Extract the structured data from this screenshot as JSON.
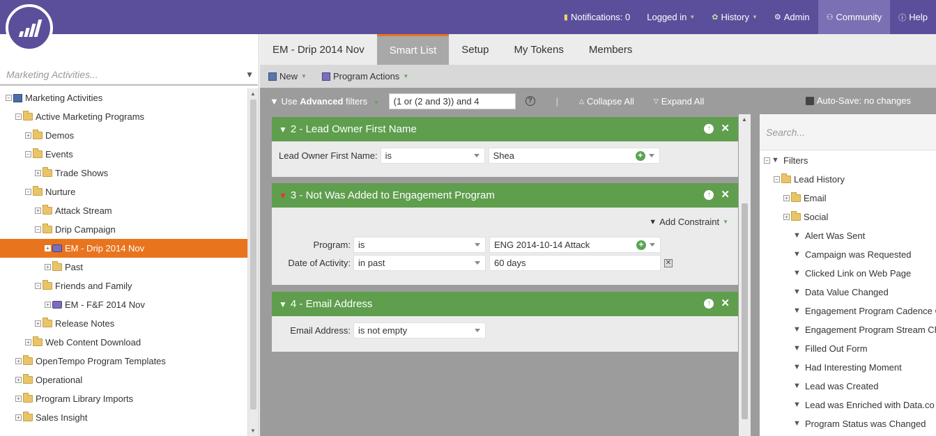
{
  "topnav": {
    "notifications": "Notifications: 0",
    "logged_in": "Logged in",
    "history": "History",
    "admin": "Admin",
    "community": "Community",
    "help": "Help"
  },
  "left_panel": {
    "search_placeholder": "Marketing Activities...",
    "tree": [
      {
        "label": "Marketing Activities",
        "level": 0,
        "icon": "program-icon",
        "exp": "−"
      },
      {
        "label": "Active Marketing Programs",
        "level": 1,
        "icon": "folder-icon",
        "exp": "−"
      },
      {
        "label": "Demos",
        "level": 2,
        "icon": "folder-icon",
        "exp": "+"
      },
      {
        "label": "Events",
        "level": 2,
        "icon": "folder-icon",
        "exp": "−"
      },
      {
        "label": "Trade Shows",
        "level": 3,
        "icon": "folder-icon",
        "exp": "+"
      },
      {
        "label": "Nurture",
        "level": 2,
        "icon": "folder-icon",
        "exp": "−"
      },
      {
        "label": "Attack Stream",
        "level": 3,
        "icon": "folder-icon",
        "exp": "+"
      },
      {
        "label": "Drip Campaign",
        "level": 3,
        "icon": "folder-icon",
        "exp": "−"
      },
      {
        "label": "EM - Drip 2014 Nov",
        "level": 4,
        "icon": "email-program-icon",
        "exp": "+",
        "selected": true
      },
      {
        "label": "Past",
        "level": 4,
        "icon": "folder-icon",
        "exp": "+"
      },
      {
        "label": "Friends and Family",
        "level": 3,
        "icon": "folder-icon",
        "exp": "−"
      },
      {
        "label": "EM - F&F 2014 Nov",
        "level": 4,
        "icon": "email-program-icon",
        "exp": "+"
      },
      {
        "label": "Release Notes",
        "level": 3,
        "icon": "folder-icon",
        "exp": "+"
      },
      {
        "label": "Web Content Download",
        "level": 2,
        "icon": "folder-icon",
        "exp": "+"
      },
      {
        "label": "OpenTempo Program Templates",
        "level": 1,
        "icon": "folder-icon",
        "exp": "+"
      },
      {
        "label": "Operational",
        "level": 1,
        "icon": "folder-icon",
        "exp": "+"
      },
      {
        "label": "Program Library Imports",
        "level": 1,
        "icon": "folder-icon",
        "exp": "+"
      },
      {
        "label": "Sales Insight",
        "level": 1,
        "icon": "folder-icon",
        "exp": "+"
      }
    ]
  },
  "tabs": [
    {
      "label": "EM - Drip 2014 Nov",
      "active": false
    },
    {
      "label": "Smart List",
      "active": true
    },
    {
      "label": "Setup",
      "active": false
    },
    {
      "label": "My Tokens",
      "active": false
    },
    {
      "label": "Members",
      "active": false
    }
  ],
  "toolbar": {
    "new_label": "New",
    "program_actions_label": "Program Actions"
  },
  "filterbar": {
    "use_label": "Use",
    "advanced_label": "Advanced",
    "filters_label": "filters",
    "logic_value": "(1 or (2 and 3)) and 4",
    "sep": "|",
    "collapse_all": "Collapse All",
    "expand_all": "Expand All",
    "autosave": "Auto-Save: no changes"
  },
  "filters": {
    "f2": {
      "title": "2 - Lead Owner First Name",
      "row_label": "Lead Owner First Name:",
      "operator": "is",
      "value": "Shea"
    },
    "f3": {
      "title": "3 - Not Was Added to Engagement Program",
      "add_constraint": "Add Constraint",
      "program_label": "Program:",
      "program_operator": "is",
      "program_value": "ENG 2014-10-14 Attack",
      "date_label": "Date of Activity:",
      "date_operator": "in past",
      "date_value": "60 days"
    },
    "f4": {
      "title": "4 - Email Address",
      "row_label": "Email Address:",
      "operator": "is not empty"
    }
  },
  "right_panel": {
    "search_placeholder": "Search...",
    "tree": [
      {
        "label": "Filters",
        "level": 0,
        "icon": "funnel-icon",
        "exp": "−"
      },
      {
        "label": "Lead History",
        "level": 1,
        "icon": "folder-icon",
        "exp": "−"
      },
      {
        "label": "Email",
        "level": 2,
        "icon": "folder-icon",
        "exp": "+"
      },
      {
        "label": "Social",
        "level": 2,
        "icon": "folder-icon",
        "exp": "+"
      },
      {
        "label": "Alert Was Sent",
        "level": 3,
        "icon": "funnel-icon"
      },
      {
        "label": "Campaign was Requested",
        "level": 3,
        "icon": "funnel-icon"
      },
      {
        "label": "Clicked Link on Web Page",
        "level": 3,
        "icon": "funnel-icon"
      },
      {
        "label": "Data Value Changed",
        "level": 3,
        "icon": "funnel-icon"
      },
      {
        "label": "Engagement Program Cadence C",
        "level": 3,
        "icon": "funnel-icon"
      },
      {
        "label": "Engagement Program Stream Ch",
        "level": 3,
        "icon": "funnel-icon"
      },
      {
        "label": "Filled Out Form",
        "level": 3,
        "icon": "funnel-icon"
      },
      {
        "label": "Had Interesting Moment",
        "level": 3,
        "icon": "funnel-icon"
      },
      {
        "label": "Lead was Created",
        "level": 3,
        "icon": "funnel-icon"
      },
      {
        "label": "Lead was Enriched with Data.co",
        "level": 3,
        "icon": "funnel-icon"
      },
      {
        "label": "Program Status was Changed",
        "level": 3,
        "icon": "funnel-icon"
      }
    ]
  },
  "colors": {
    "header_purple": "#5b4f9b",
    "selected_orange": "#e9741e",
    "filter_green": "#5e9e4d"
  }
}
